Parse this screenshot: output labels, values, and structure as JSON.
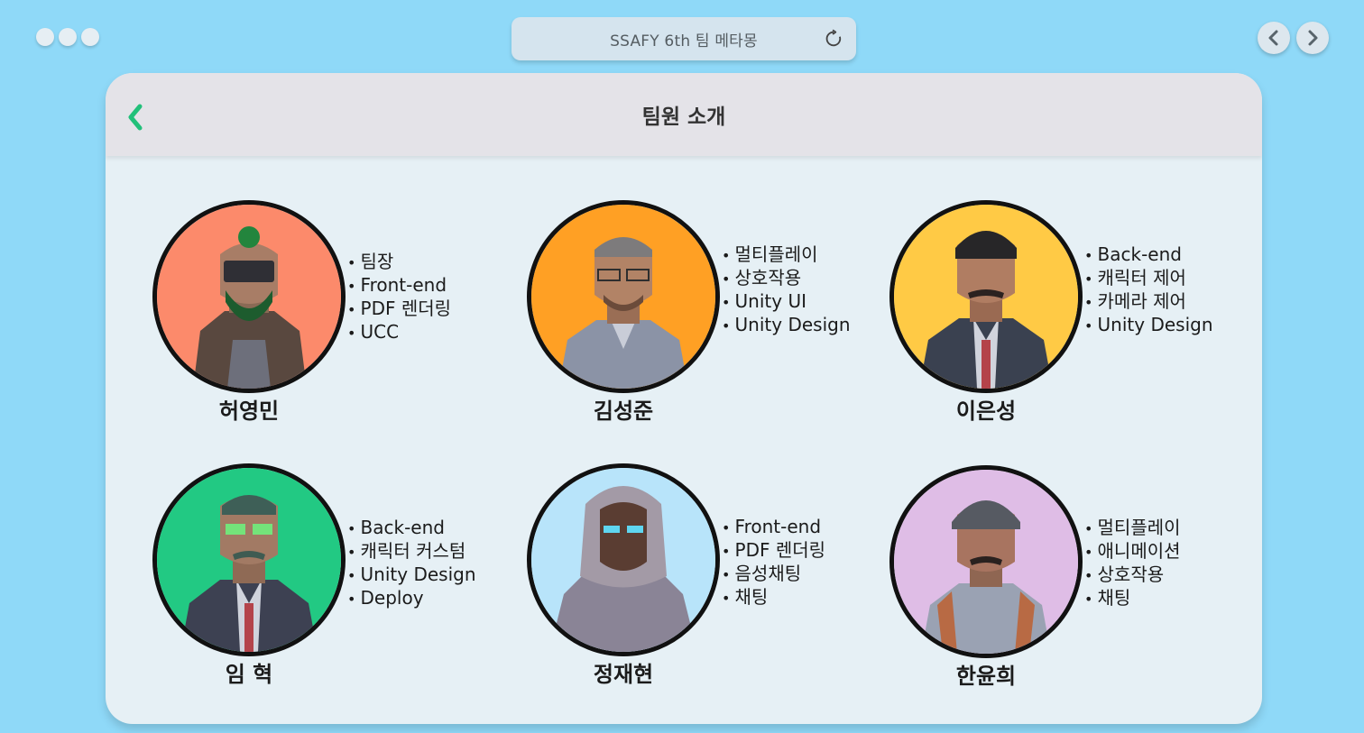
{
  "browser": {
    "address_title": "SSAFY 6th 팀 메타몽",
    "reload_icon": "reload-icon",
    "back_icon": "chevron-left-icon",
    "forward_icon": "chevron-right-icon"
  },
  "page": {
    "title": "팀원 소개",
    "back_icon": "back-arrow-icon",
    "accent_color": "#22c07a"
  },
  "members": [
    {
      "name": "허영민",
      "color": "#fc8a6b",
      "roles": [
        "팀장",
        "Front-end",
        "PDF 렌더링",
        "UCC"
      ]
    },
    {
      "name": "김성준",
      "color": "#ffa024",
      "roles": [
        "멀티플레이",
        "상호작용",
        "Unity UI",
        "Unity Design"
      ]
    },
    {
      "name": "이은성",
      "color": "#ffca45",
      "roles": [
        "Back-end",
        "캐릭터 제어",
        "카메라 제어",
        "Unity Design"
      ]
    },
    {
      "name": "임 혁",
      "color": "#22c983",
      "roles": [
        "Back-end",
        "캐릭터 커스텀",
        "Unity Design",
        "Deploy"
      ]
    },
    {
      "name": "정재현",
      "color": "#b8e4fa",
      "roles": [
        "Front-end",
        "PDF 렌더링",
        "음성채팅",
        "채팅"
      ]
    },
    {
      "name": "한윤희",
      "color": "#dfbde6",
      "roles": [
        "멀티플레이",
        "애니메이션",
        "상호작용",
        "채팅"
      ]
    }
  ]
}
